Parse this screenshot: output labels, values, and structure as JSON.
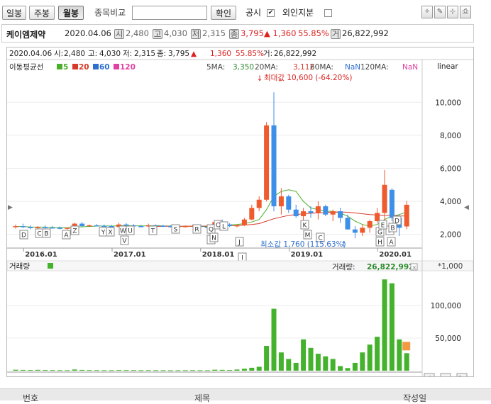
{
  "toolbar": {
    "daily": "일봉",
    "weekly": "주봉",
    "monthly": "월봉",
    "compare_label": "종목비교",
    "compare_input": "",
    "confirm": "확인",
    "disclosure": "공시",
    "foreign": "외인지분",
    "disclosure_checked": "✔"
  },
  "info": {
    "name": "케이엠제약",
    "date": "2020.04.06",
    "open": "2,480",
    "high": "4,030",
    "low": "2,315",
    "close": "3,795",
    "change": "▲ 1,360",
    "pct": "55.85%",
    "volume": "26,822,992",
    "b_open": "시",
    "b_high": "고",
    "b_low": "저",
    "b_close": "종",
    "b_volume": "거"
  },
  "chart_head": {
    "line1": [
      "2020.04.06",
      "시:",
      "2,480",
      "고:",
      "4,030",
      "저:",
      "2,315",
      "종:",
      "3,795",
      "▲",
      "1,360",
      "55.85%",
      "거:",
      "26,822,992"
    ],
    "ma_title": "이동평균선",
    "ma_legend": [
      {
        "label": "5",
        "color": "#4caf2a"
      },
      {
        "label": "20",
        "color": "#d83a2a"
      },
      {
        "label": "60",
        "color": "#2e6fd0"
      },
      {
        "label": "120",
        "color": "#e040a0"
      }
    ],
    "ma_values": [
      {
        "label": "5MA:",
        "value": "3,350",
        "color": "#2e8b2e"
      },
      {
        "label": "20MA:",
        "value": "3,112",
        "color": "#d83a2a"
      },
      {
        "label": "60MA:",
        "value": "NaN",
        "color": "#2e6fd0"
      },
      {
        "label": "120MA:",
        "value": "NaN",
        "color": "#e040a0"
      }
    ],
    "scale": "linear",
    "max_note": "최대값 10,600 (-64.20%)",
    "min_note": "최소값 1,760 (115.63%)"
  },
  "volume_head": {
    "title": "거래량",
    "label": "거래량:",
    "value": "26,822,992",
    "unit": "*1,000"
  },
  "bottom": {
    "col1": "번호",
    "col2": "제목",
    "col3": "작성일"
  },
  "colors": {
    "up": "#ef5a2e",
    "down": "#3d8fe8",
    "volume": "#44b22c",
    "ma5": "#4caf2a",
    "ma20": "#d83a2a"
  },
  "chart_data": [
    {
      "type": "candlestick",
      "title": "",
      "ylabel": "",
      "y_ticks": [
        2000,
        4000,
        6000,
        8000,
        10000
      ],
      "y_tick_labels": [
        "2,000",
        "4,000",
        "6,000",
        "8,000",
        "10,000"
      ],
      "ylim": [
        1300,
        11600
      ],
      "x_tick_labels": [
        "2016.01",
        "2017.01",
        "2018.01",
        "2019.01",
        "2020.01"
      ],
      "x_tick_index": [
        3,
        15,
        27,
        39,
        51
      ],
      "note": "monthly candles, values estimated from axis",
      "candles": [
        [
          2450,
          2600,
          2350,
          2500
        ],
        [
          2500,
          2650,
          2380,
          2450
        ],
        [
          2450,
          2550,
          2300,
          2380
        ],
        [
          2380,
          2500,
          2300,
          2450
        ],
        [
          2450,
          2550,
          2350,
          2420
        ],
        [
          2420,
          2500,
          2350,
          2400
        ],
        [
          2400,
          2480,
          2300,
          2350
        ],
        [
          2350,
          2420,
          2280,
          2400
        ],
        [
          2400,
          2700,
          2380,
          2650
        ],
        [
          2650,
          2750,
          2450,
          2500
        ],
        [
          2500,
          2600,
          2450,
          2550
        ],
        [
          2550,
          2620,
          2480,
          2520
        ],
        [
          2520,
          2600,
          2450,
          2500
        ],
        [
          2500,
          2580,
          2420,
          2450
        ],
        [
          2450,
          2700,
          2420,
          2600
        ],
        [
          2600,
          2680,
          2500,
          2550
        ],
        [
          2550,
          2620,
          2450,
          2500
        ],
        [
          2500,
          2580,
          2420,
          2480
        ],
        [
          2480,
          2650,
          2450,
          2550
        ],
        [
          2550,
          2600,
          2480,
          2520
        ],
        [
          2520,
          2580,
          2450,
          2500
        ],
        [
          2500,
          2560,
          2420,
          2450
        ],
        [
          2450,
          2520,
          2400,
          2480
        ],
        [
          2480,
          2550,
          2420,
          2500
        ],
        [
          2500,
          2580,
          2450,
          2520
        ],
        [
          2520,
          2580,
          2440,
          2460
        ],
        [
          2460,
          2520,
          2400,
          2440
        ],
        [
          2440,
          2800,
          2420,
          2750
        ],
        [
          2750,
          2900,
          2550,
          2600
        ],
        [
          2600,
          2680,
          2450,
          2500
        ],
        [
          2500,
          2600,
          2420,
          2550
        ],
        [
          2550,
          3000,
          2500,
          2900
        ],
        [
          2900,
          3800,
          2850,
          3600
        ],
        [
          3600,
          4300,
          3400,
          4100
        ],
        [
          4100,
          8800,
          4000,
          8600
        ],
        [
          8600,
          10600,
          3400,
          3700
        ],
        [
          3700,
          4800,
          3200,
          4300
        ],
        [
          4300,
          4400,
          3300,
          3500
        ],
        [
          3500,
          3800,
          3000,
          3100
        ],
        [
          3100,
          3600,
          2800,
          3400
        ],
        [
          3400,
          3700,
          3000,
          3300
        ],
        [
          3300,
          4000,
          2900,
          3700
        ],
        [
          3700,
          3800,
          3100,
          3200
        ],
        [
          3200,
          3500,
          2800,
          3400
        ],
        [
          3400,
          3600,
          2700,
          3000
        ],
        [
          3000,
          3200,
          2300,
          2300
        ],
        [
          2300,
          2500,
          1760,
          2100
        ],
        [
          2100,
          2600,
          1900,
          2400
        ],
        [
          2400,
          2900,
          2100,
          2800
        ],
        [
          2800,
          3600,
          2700,
          3300
        ],
        [
          3300,
          5900,
          2400,
          5000
        ],
        [
          4700,
          4800,
          2800,
          3000
        ],
        [
          3000,
          3200,
          1900,
          2400
        ],
        [
          2480,
          4030,
          2315,
          3795
        ]
      ],
      "ma5": [
        2480,
        2470,
        2450,
        2440,
        2440,
        2420,
        2410,
        2400,
        2440,
        2460,
        2480,
        2500,
        2510,
        2500,
        2520,
        2530,
        2520,
        2510,
        2520,
        2530,
        2510,
        2500,
        2490,
        2490,
        2490,
        2480,
        2470,
        2530,
        2560,
        2570,
        2600,
        2650,
        2750,
        2900,
        3500,
        4300,
        4600,
        4700,
        4600,
        4000,
        3600,
        3500,
        3400,
        3400,
        3300,
        3100,
        2800,
        2600,
        2500,
        2600,
        2900,
        3100,
        3200,
        3350
      ],
      "ma20": [
        null,
        null,
        null,
        null,
        null,
        null,
        null,
        null,
        null,
        null,
        null,
        null,
        null,
        null,
        null,
        null,
        null,
        null,
        null,
        2480,
        2490,
        2490,
        2490,
        2490,
        2500,
        2500,
        2500,
        2510,
        2520,
        2530,
        2540,
        2560,
        2600,
        2650,
        2800,
        2950,
        3050,
        3150,
        3200,
        3250,
        3280,
        3300,
        3320,
        3350,
        3360,
        3340,
        3300,
        3250,
        3200,
        3170,
        3150,
        3140,
        3120,
        3112
      ]
    },
    {
      "type": "bar",
      "title": "",
      "ylabel": "",
      "y_ticks": [
        50000,
        100000
      ],
      "y_tick_labels": [
        "50,000",
        "100,000"
      ],
      "ylim": [
        0,
        150000
      ],
      "values": [
        1500,
        1200,
        1000,
        1300,
        1000,
        900,
        800,
        700,
        1800,
        1200,
        900,
        800,
        700,
        700,
        1000,
        900,
        800,
        700,
        800,
        700,
        700,
        600,
        600,
        700,
        800,
        700,
        600,
        1500,
        1300,
        1000,
        1800,
        3000,
        4500,
        6000,
        38000,
        95000,
        28000,
        18000,
        12000,
        48000,
        35000,
        26000,
        22000,
        18000,
        7000,
        4000,
        12000,
        28000,
        40000,
        52000,
        140000,
        134000,
        48000,
        26823
      ]
    }
  ],
  "markers": {
    "row_upper": [
      "D",
      "C",
      "B",
      "A",
      "Z",
      "Y",
      "X",
      "W",
      "U",
      "T",
      "S",
      "R",
      "Q",
      "P",
      "O",
      "L"
    ],
    "row_lower": [
      "V",
      "N",
      "M",
      "K",
      "J",
      "I",
      "H",
      "G",
      "F",
      "E",
      "D",
      "C",
      "B",
      "A"
    ]
  }
}
